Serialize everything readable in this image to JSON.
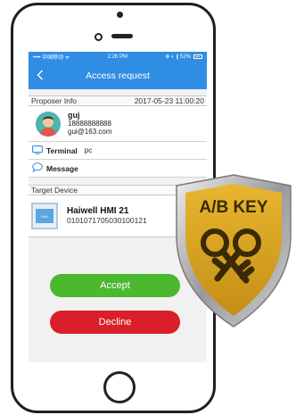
{
  "status_bar": {
    "carrier": "•••• 中国移动 ᯤ",
    "time": "2:26 PM",
    "right_icons": "⊕ ◐ ∦ 52%"
  },
  "nav": {
    "title": "Access request",
    "back_icon": "chevron-left-icon"
  },
  "proposer": {
    "header_label": "Proposer Info",
    "timestamp": "2017-05-23 11:00:20",
    "name": "guj",
    "phone": "18888888888",
    "email": "gui@163.com"
  },
  "terminal": {
    "label": "Terminal",
    "value": "pc"
  },
  "message": {
    "label": "Message"
  },
  "target": {
    "header_label": "Target Device",
    "device_name": "Haiwell HMI 21",
    "device_serial": "010107170503010012​1",
    "icon_text": "HMI"
  },
  "actions": {
    "accept_label": "Accept",
    "decline_label": "Decline"
  },
  "badge": {
    "text": "A/B KEY"
  },
  "colors": {
    "nav_blue": "#2f8de4",
    "accept_green": "#4cb82e",
    "decline_red": "#d81f2a",
    "badge_gold": "#d9a521"
  }
}
